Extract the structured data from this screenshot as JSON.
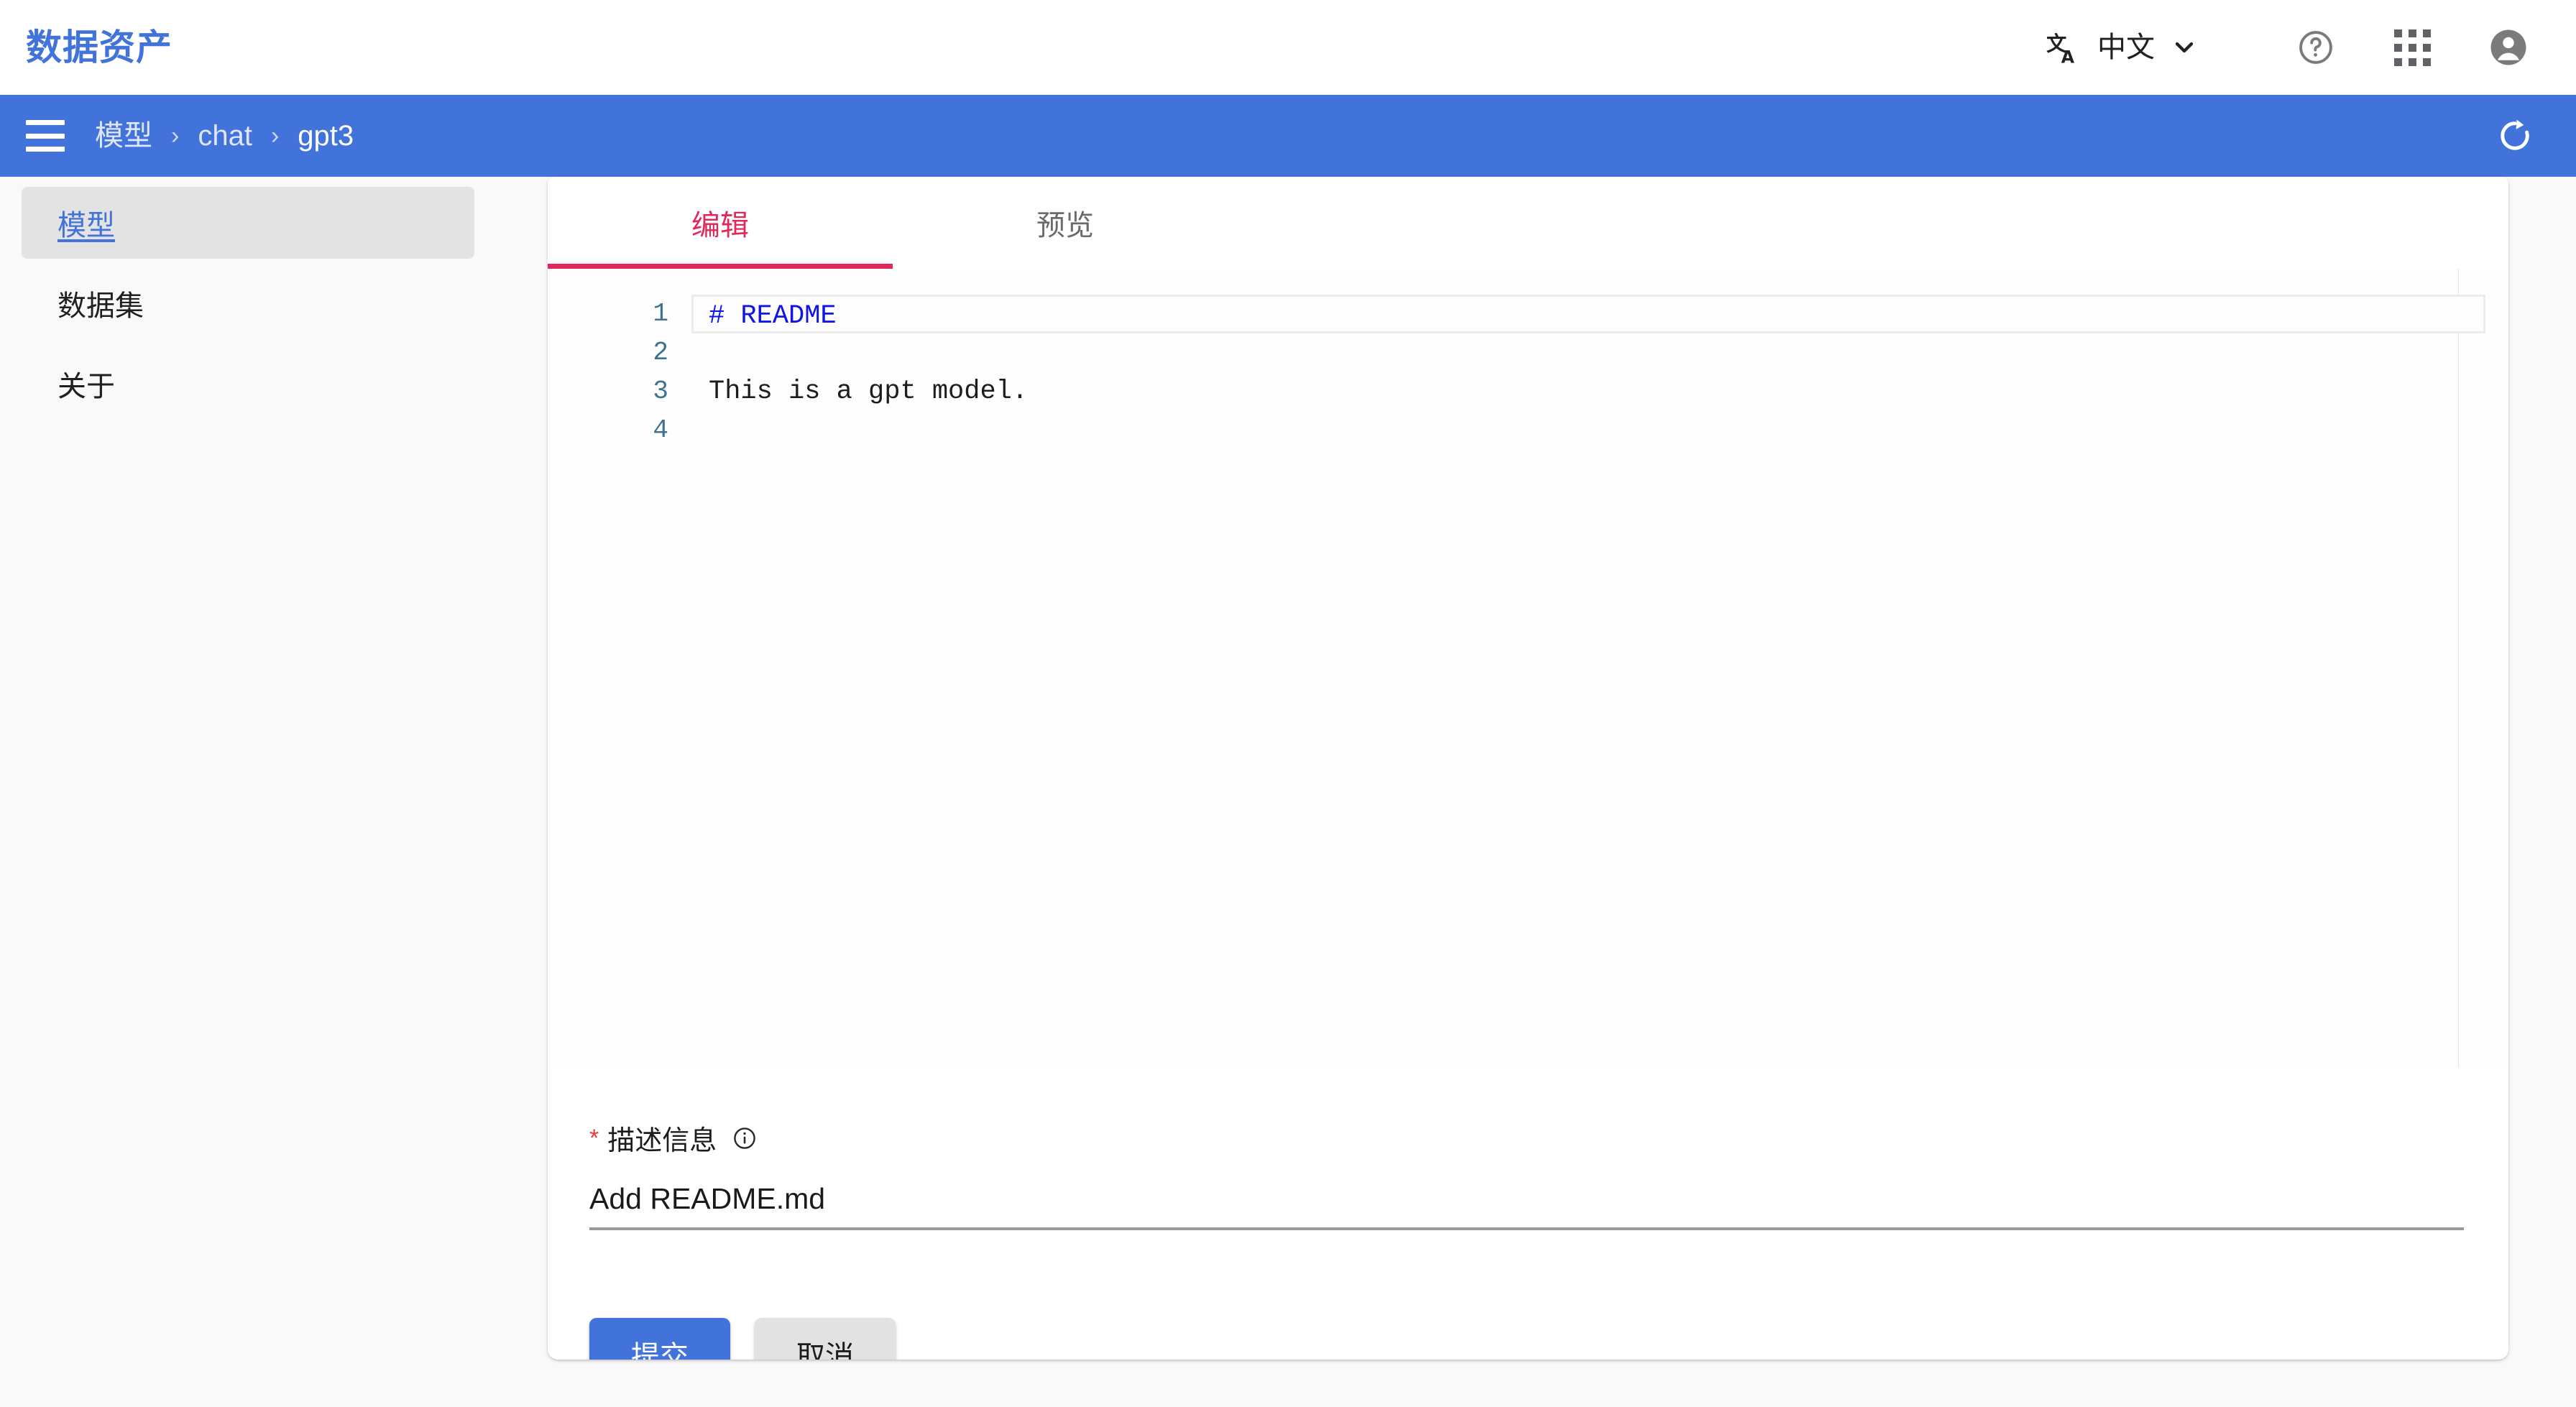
{
  "header": {
    "brand": "数据资产",
    "translate_icon": "translate-icon",
    "language_label": "中文",
    "chevron_icon": "chevron-down-icon",
    "help_icon": "help-circle-icon",
    "apps_icon": "apps-grid-icon",
    "account_icon": "account-circle-icon"
  },
  "breadcrumb": {
    "menu_icon": "hamburger-menu-icon",
    "items": [
      {
        "label": "模型",
        "current": false
      },
      {
        "label": "chat",
        "current": false
      },
      {
        "label": "gpt3",
        "current": true
      }
    ],
    "separator": "›",
    "refresh_icon": "refresh-icon"
  },
  "sidebar": {
    "items": [
      {
        "label": "模型",
        "active": true
      },
      {
        "label": "数据集",
        "active": false
      },
      {
        "label": "关于",
        "active": false
      }
    ]
  },
  "main": {
    "tabs": [
      {
        "label": "编辑",
        "active": true
      },
      {
        "label": "预览",
        "active": false
      }
    ],
    "editor": {
      "lines": [
        {
          "number": "1",
          "text": "# README",
          "markdown_heading": true,
          "active": true
        },
        {
          "number": "2",
          "text": "",
          "markdown_heading": false,
          "active": false
        },
        {
          "number": "3",
          "text": "This is a gpt model.",
          "markdown_heading": false,
          "active": false
        },
        {
          "number": "4",
          "text": "",
          "markdown_heading": false,
          "active": false
        }
      ]
    },
    "description": {
      "required_marker": "*",
      "label": "描述信息",
      "info_icon": "info-circle-icon",
      "value": "Add README.md",
      "placeholder": ""
    },
    "actions": {
      "submit_label": "提交",
      "cancel_label": "取消"
    }
  },
  "colors": {
    "brand_blue": "#4273da",
    "tab_active": "#e0285a",
    "required_red": "#e53935",
    "markdown_blue": "#0f15e6",
    "gutter_blue": "#3d7290"
  }
}
